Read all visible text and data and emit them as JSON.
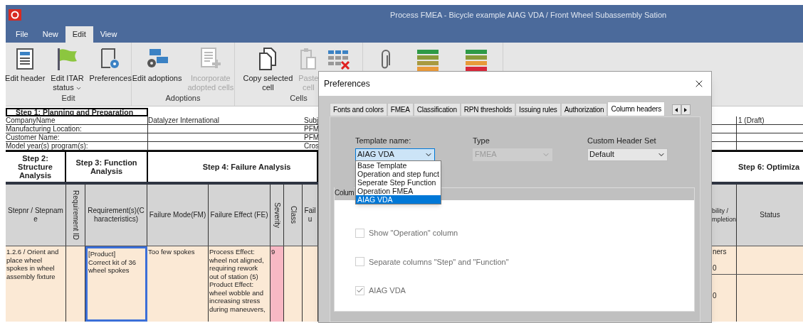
{
  "window": {
    "title": "Process FMEA - Bicycle example AIAG VDA / Front Wheel Subassembly Sation"
  },
  "menu_tabs": [
    {
      "label": "File",
      "selected": false
    },
    {
      "label": "New",
      "selected": false
    },
    {
      "label": "Edit",
      "selected": true
    },
    {
      "label": "View",
      "selected": false
    }
  ],
  "ribbon": {
    "groups": [
      {
        "label": "Edit",
        "buttons": [
          {
            "lines": [
              "Edit header"
            ],
            "disabled": false,
            "dropdown": false
          },
          {
            "lines": [
              "Edit ITAR",
              "status"
            ],
            "disabled": false,
            "dropdown": true
          },
          {
            "lines": [
              "Preferences"
            ],
            "disabled": false,
            "dropdown": false
          }
        ]
      },
      {
        "label": "Adoptions",
        "buttons": [
          {
            "lines": [
              "Edit adoptions"
            ],
            "disabled": false,
            "dropdown": false
          },
          {
            "lines": [
              "Incorporate",
              "adopted cells"
            ],
            "disabled": true,
            "dropdown": false
          }
        ]
      },
      {
        "label": "Cells",
        "buttons": [
          {
            "lines": [
              "Copy selected",
              "cell"
            ],
            "disabled": false,
            "dropdown": false
          },
          {
            "lines": [
              "Paste",
              "cell"
            ],
            "disabled": true,
            "dropdown": false
          }
        ]
      }
    ]
  },
  "sheet": {
    "planning": {
      "title": "Step 1: Planning and Preparation",
      "rows": [
        {
          "label": "CompanyName",
          "value": "Datalyzer International",
          "column_3": "Subj",
          "column_5": "1 (Draft)"
        },
        {
          "label": "Manufacturing Location:",
          "column_3": "PFM"
        },
        {
          "label": "Customer Name:",
          "column_3": "PFM"
        },
        {
          "label": "Model year(s) program(s):",
          "column_3": "Cros"
        }
      ]
    },
    "steps": [
      "Step 2: Structure Analysis",
      "Step 3: Function Analysis",
      "Step 4: Failure Analysis"
    ],
    "right_step": "Step 6: Optimiza",
    "columns": [
      {
        "label": "Stepnr / Stepname",
        "vertical": false
      },
      {
        "label": "Requirement ID",
        "vertical": true
      },
      {
        "label": "Requirement(s)(Characteristics)",
        "vertical": false
      },
      {
        "label": "Failure Mode(FM)",
        "vertical": false
      },
      {
        "label": "Failure Effect (FE)",
        "vertical": false
      },
      {
        "label": "Severity",
        "vertical": true
      },
      {
        "label": "Class",
        "vertical": true
      },
      {
        "label": "Failu",
        "vertical": false
      }
    ],
    "right_columns": [
      {
        "lines": [
          "bility /",
          "mpletion"
        ]
      },
      {
        "lines": [
          "Status"
        ]
      }
    ],
    "rows": [
      {
        "cells": [
          {
            "text": "1.2.6 / Orient and place wheel spokes in wheel assembly fixture",
            "selected": false
          },
          {
            "text": "",
            "selected": false
          },
          {
            "text": "[Product]\nCorrect kit of 36 wheel spokes",
            "selected": true
          },
          {
            "text": "Too few spokes",
            "selected": false
          },
          {
            "text": "Process Effect:\nwheel not aligned,\nrequiring rework\nout of station (5)\nProduct Effect:\nwheel wobble and\nincreasing stress\nduring maneuvers,",
            "selected": false
          },
          {
            "text": "9",
            "selected": false,
            "color": "#f8b8c4"
          },
          {
            "text": "",
            "selected": false
          },
          {
            "text": "",
            "selected": false
          }
        ]
      }
    ],
    "right_rows": [
      {
        "texts": [
          "ners",
          "0"
        ]
      },
      {
        "texts": [
          "0"
        ]
      }
    ]
  },
  "dialog": {
    "title": "Preferences",
    "tabs": [
      {
        "label": "Fonts and colors",
        "selected": false
      },
      {
        "label": "FMEA",
        "selected": false
      },
      {
        "label": "Classification",
        "selected": false
      },
      {
        "label": "RPN thresholds",
        "selected": false
      },
      {
        "label": "Issuing rules",
        "selected": false
      },
      {
        "label": "Authorization",
        "selected": false
      },
      {
        "label": "Column headers",
        "selected": true
      }
    ],
    "template": {
      "label": "Template name:",
      "value": "AIAG VDA",
      "expanded": true,
      "options": [
        {
          "label": "Base Template",
          "selected": false
        },
        {
          "label": "Operation and step funct",
          "selected": false
        },
        {
          "label": "Seperate Step Function",
          "selected": false
        },
        {
          "label": "Operation FMEA",
          "selected": false
        },
        {
          "label": "AIAG VDA",
          "selected": true
        }
      ]
    },
    "type": {
      "label": "Type",
      "value": "FMEA",
      "disabled": true
    },
    "custom_header_set": {
      "label": "Custom Header Set",
      "value": "Default",
      "disabled": false
    },
    "group_title": "Colum",
    "checkboxes": [
      {
        "label": "Show \"Operation\" column",
        "checked": false,
        "disabled": true
      },
      {
        "label": "Separate columns \"Step\" and \"Function\"",
        "checked": false,
        "disabled": true
      },
      {
        "label": "AIAG VDA",
        "checked": true,
        "disabled": true
      }
    ]
  }
}
